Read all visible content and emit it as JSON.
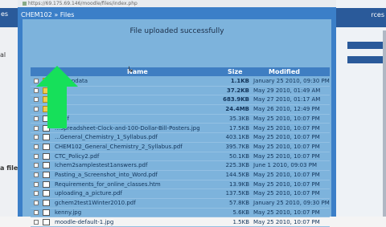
{
  "browser": {
    "url": "https://69.175.69.146/moodle/files/index.php"
  },
  "background_left": {
    "bar_label": "es",
    "text_1": "al",
    "text_2": "a file"
  },
  "background_right": {
    "bar_label": "rces"
  },
  "breadcrumb": "CHEM102 » Files",
  "message": "File uploaded successfully",
  "columns": {
    "name": "Name",
    "size": "Size",
    "modified": "Modified"
  },
  "files": [
    {
      "name": "backupdata",
      "size": "1.1KB",
      "date": "January 25 2010, 09:30 PM",
      "type": "folder",
      "bold": true
    },
    {
      "name": "",
      "size": "37.2KB",
      "date": "May 29 2010, 01:49 AM",
      "type": "folder",
      "bold": true
    },
    {
      "name": "",
      "size": "683.9KB",
      "date": "May 27 2010, 01:17 AM",
      "type": "folder",
      "bold": true
    },
    {
      "name": "",
      "size": "24.4MB",
      "date": "May 26 2010, 12:49 PM",
      "type": "folder",
      "bold": true
    },
    {
      "name": "...pdf",
      "size": "35.3KB",
      "date": "May 25 2010, 10:07 PM",
      "type": "file",
      "bold": false
    },
    {
      "name": "...Spreadsheet-Clock-and-100-Dollar-Bill-Posters.jpg",
      "size": "17.5KB",
      "date": "May 25 2010, 10:07 PM",
      "type": "file",
      "bold": false
    },
    {
      "name": "...General_Chemistry_1_Syllabus.pdf",
      "size": "403.1KB",
      "date": "May 25 2010, 10:07 PM",
      "type": "file",
      "bold": false
    },
    {
      "name": "CHEM102_General_Chemistry_2_Syllabus.pdf",
      "size": "395.7KB",
      "date": "May 25 2010, 10:07 PM",
      "type": "file",
      "bold": false
    },
    {
      "name": "CTC_Policy2.pdf",
      "size": "50.1KB",
      "date": "May 25 2010, 10:07 PM",
      "type": "file",
      "bold": false
    },
    {
      "name": "Ichem2samplestest1answers.pdf",
      "size": "225.3KB",
      "date": "June 1 2010, 09:03 PM",
      "type": "file",
      "bold": false
    },
    {
      "name": "Pasting_a_Screenshot_into_Word.pdf",
      "size": "144.5KB",
      "date": "May 25 2010, 10:07 PM",
      "type": "file",
      "bold": false
    },
    {
      "name": "Requirements_for_online_classes.htm",
      "size": "13.9KB",
      "date": "May 25 2010, 10:07 PM",
      "type": "file",
      "bold": false
    },
    {
      "name": "uploading_a_picture.pdf",
      "size": "137.5KB",
      "date": "May 25 2010, 10:07 PM",
      "type": "file",
      "bold": false
    },
    {
      "name": "gchem2test1Winter2010.pdf",
      "size": "57.8KB",
      "date": "January 25 2010, 09:30 PM",
      "type": "file",
      "bold": false
    },
    {
      "name": "kenny.jpg",
      "size": "5.6KB",
      "date": "May 25 2010, 10:07 PM",
      "type": "file",
      "bold": false
    },
    {
      "name": "moodle-default-1.jpg",
      "size": "1.5KB",
      "date": "May 25 2010, 10:07 PM",
      "type": "file",
      "bold": false
    }
  ],
  "colors": {
    "window": "#3b7fc8",
    "panel": "#7db3dc",
    "header": "#3f7ec2",
    "arrow": "#16e05a",
    "link": "#12345a"
  }
}
